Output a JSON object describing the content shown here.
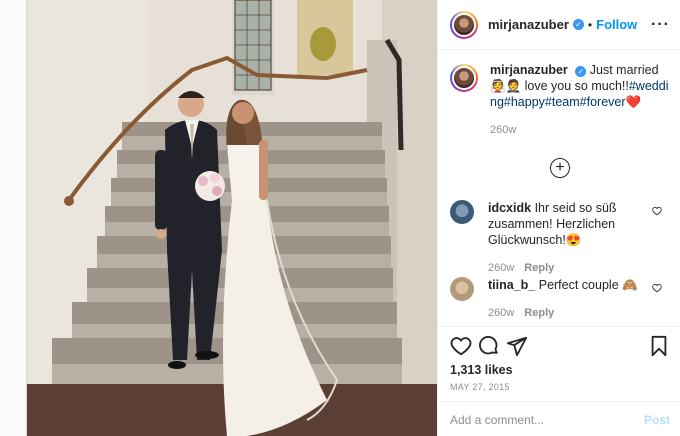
{
  "header": {
    "username": "mirjanazuber",
    "separator": "•",
    "follow_label": "Follow",
    "more_label": "···"
  },
  "caption": {
    "username": "mirjanazuber",
    "text_intro": "Just married",
    "emoji_1": "👰",
    "emoji_2": "🤵",
    "line_2": "love you so much!!",
    "hashtags": "#wedding#happy#team#forever",
    "emoji_heart": "❤️",
    "time_ago": "260w"
  },
  "load_more_icon": "plus-circle-icon",
  "comments": [
    {
      "username": "idcxidk",
      "text": "Ihr seid so süß zusammen! Herzlichen Glückwunsch!",
      "emoji": "😍",
      "time_ago": "260w",
      "reply_label": "Reply",
      "avatar_color": "#3b5a78"
    },
    {
      "username": "tiina_b_",
      "text": "Perfect couple",
      "emoji": "🙈",
      "time_ago": "260w",
      "reply_label": "Reply",
      "avatar_color": "#b49a7a"
    }
  ],
  "actions": {
    "icons": [
      "heart-icon",
      "comment-icon",
      "share-icon",
      "bookmark-icon"
    ],
    "likes": "1,313 likes",
    "date": "MAY 27, 2015"
  },
  "add_comment": {
    "placeholder": "Add a comment...",
    "post_label": "Post"
  },
  "colors": {
    "link": "#0095f6",
    "hashtag": "#00376b",
    "muted": "#8e8e8e",
    "verified": "#3897f0"
  }
}
